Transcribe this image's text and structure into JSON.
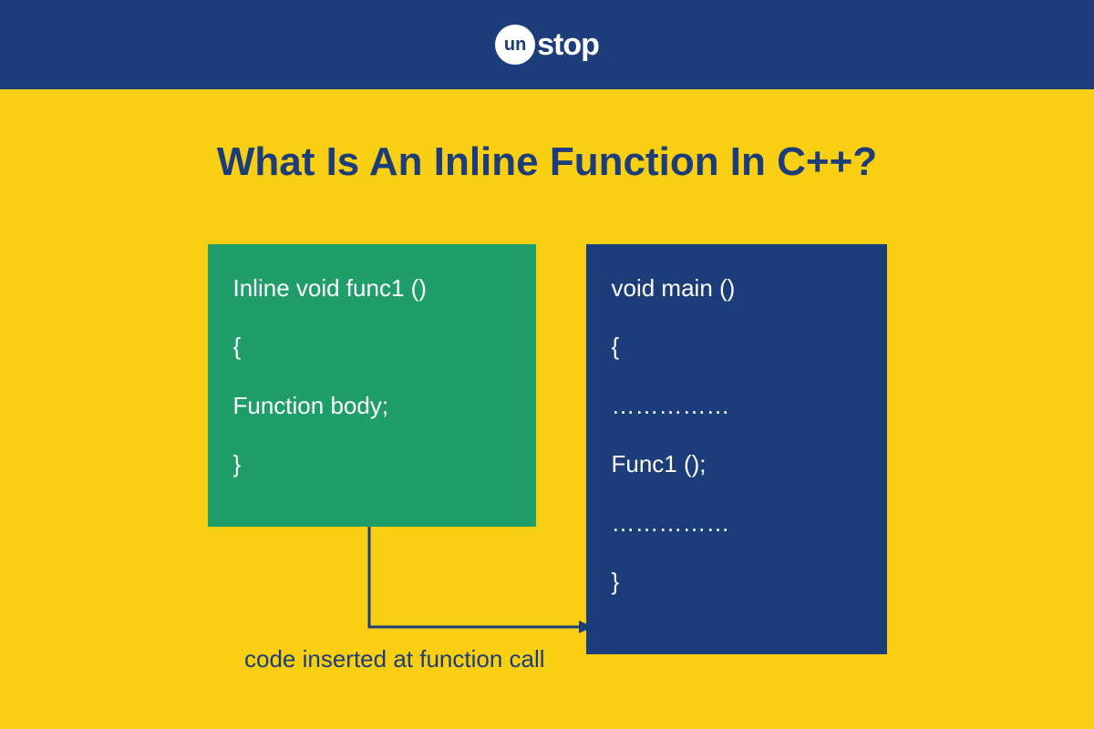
{
  "header": {
    "logo_circle": "un",
    "logo_text": "stop"
  },
  "title": "What Is An Inline Function In C++?",
  "diagram": {
    "green_box": {
      "line1": "Inline void func1 ()",
      "line2": "{",
      "line3": "Function body;",
      "line4": "}"
    },
    "blue_box": {
      "line1": "void main ()",
      "line2": "{",
      "line3": "……………",
      "line4": "Func1 ();",
      "line5": "……………",
      "line6": "}"
    },
    "arrow_label": "code inserted at function call"
  },
  "colors": {
    "header_bg": "#1c3d7a",
    "page_bg": "#f8cf12",
    "green": "#1f9e6a",
    "blue": "#1c3d7a"
  }
}
